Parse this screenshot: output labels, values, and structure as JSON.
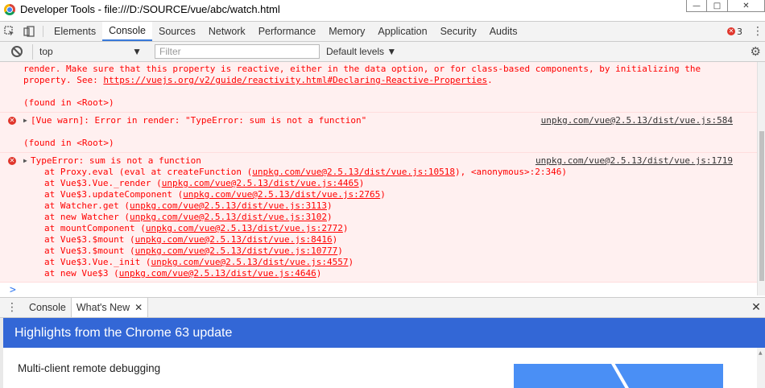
{
  "window": {
    "title": "Developer Tools - file:///D:/SOURCE/vue/abc/watch.html",
    "minimize": "—",
    "maximize": "□",
    "close": "✕"
  },
  "tabs": [
    "Elements",
    "Console",
    "Sources",
    "Network",
    "Performance",
    "Memory",
    "Application",
    "Security",
    "Audits"
  ],
  "active_tab": "Console",
  "error_count": "3",
  "toolbar": {
    "context": "top",
    "filter_placeholder": "Filter",
    "levels": "Default levels"
  },
  "console": {
    "warn_continued": [
      "render. Make sure that this property is reactive, either in the data option, or for class-based components, by initializing the",
      "property. See: "
    ],
    "warn_link": "https://vuejs.org/v2/guide/reactivity.html#Declaring-Reactive-Properties",
    "warn_end": ".",
    "found_in_1": "(found in <Root>)",
    "err1_text": "[Vue warn]: Error in render: \"TypeError: sum is not a function\"",
    "err1_src": "unpkg.com/vue@2.5.13/dist/vue.js:584",
    "found_in_2": "(found in <Root>)",
    "err2_text": "TypeError: sum is not a function",
    "err2_src": "unpkg.com/vue@2.5.13/dist/vue.js:1719",
    "stack": [
      {
        "fn": "at Proxy.eval (eval at createFunction (",
        "link": "unpkg.com/vue@2.5.13/dist/vue.js:10518",
        "tail": "), <anonymous>:2:346)"
      },
      {
        "fn": "at Vue$3.Vue._render (",
        "link": "unpkg.com/vue@2.5.13/dist/vue.js:4465",
        "tail": ")"
      },
      {
        "fn": "at Vue$3.updateComponent (",
        "link": "unpkg.com/vue@2.5.13/dist/vue.js:2765",
        "tail": ")"
      },
      {
        "fn": "at Watcher.get (",
        "link": "unpkg.com/vue@2.5.13/dist/vue.js:3113",
        "tail": ")"
      },
      {
        "fn": "at new Watcher (",
        "link": "unpkg.com/vue@2.5.13/dist/vue.js:3102",
        "tail": ")"
      },
      {
        "fn": "at mountComponent (",
        "link": "unpkg.com/vue@2.5.13/dist/vue.js:2772",
        "tail": ")"
      },
      {
        "fn": "at Vue$3.$mount (",
        "link": "unpkg.com/vue@2.5.13/dist/vue.js:8416",
        "tail": ")"
      },
      {
        "fn": "at Vue$3.$mount (",
        "link": "unpkg.com/vue@2.5.13/dist/vue.js:10777",
        "tail": ")"
      },
      {
        "fn": "at Vue$3.Vue._init (",
        "link": "unpkg.com/vue@2.5.13/dist/vue.js:4557",
        "tail": ")"
      },
      {
        "fn": "at new Vue$3 (",
        "link": "unpkg.com/vue@2.5.13/dist/vue.js:4646",
        "tail": ")"
      }
    ],
    "prompt": ">"
  },
  "drawer": {
    "tabs": [
      "Console",
      "What's New"
    ],
    "active": "What's New",
    "banner": "Highlights from the Chrome 63 update",
    "first_item": "Multi-client remote debugging"
  },
  "colors": {
    "error_red": "#ff0000",
    "error_bg": "#fff0f0",
    "accent_blue": "#3367d6",
    "tab_underline": "#3879d9"
  },
  "icons": [
    "chrome-logo",
    "inspect-icon",
    "device-toggle-icon",
    "error-icon",
    "kebab-menu-icon",
    "clear-console-icon",
    "settings-gear-icon",
    "close-icon"
  ]
}
